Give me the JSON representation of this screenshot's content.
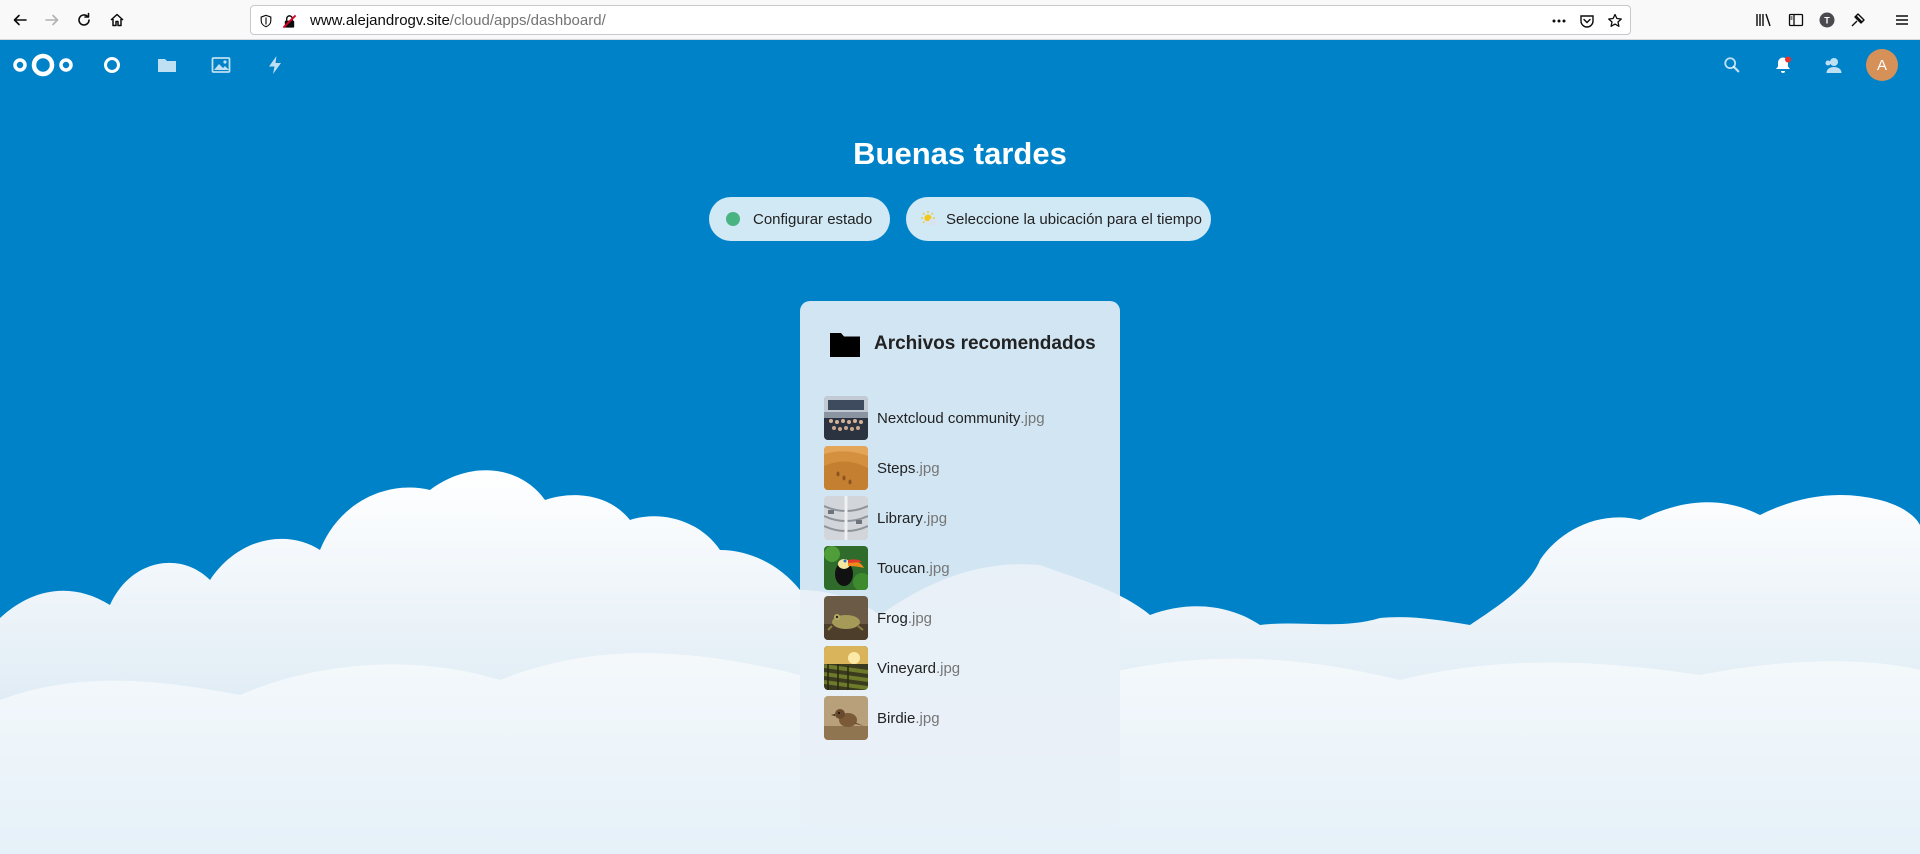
{
  "browser": {
    "url_domain": "www.alejandrogv.site",
    "url_path": "/cloud/apps/dashboard/",
    "account_initial": "T"
  },
  "header": {
    "avatar_initial": "A",
    "apps": [
      "dashboard-icon",
      "files-icon",
      "photos-icon",
      "activity-icon"
    ],
    "accent_color": "#0082c9"
  },
  "dashboard": {
    "greeting": "Buenas tardes",
    "status_button": "Configurar estado",
    "weather_button": "Seleccione la ubicación para el tiempo",
    "status_color": "#49b382"
  },
  "recommended_files": {
    "title": "Archivos recomendados",
    "items": [
      {
        "name": "Nextcloud community",
        "ext": ".jpg"
      },
      {
        "name": "Steps",
        "ext": ".jpg"
      },
      {
        "name": "Library",
        "ext": ".jpg"
      },
      {
        "name": "Toucan",
        "ext": ".jpg"
      },
      {
        "name": "Frog",
        "ext": ".jpg"
      },
      {
        "name": "Vineyard",
        "ext": ".jpg"
      },
      {
        "name": "Birdie",
        "ext": ".jpg"
      }
    ]
  }
}
